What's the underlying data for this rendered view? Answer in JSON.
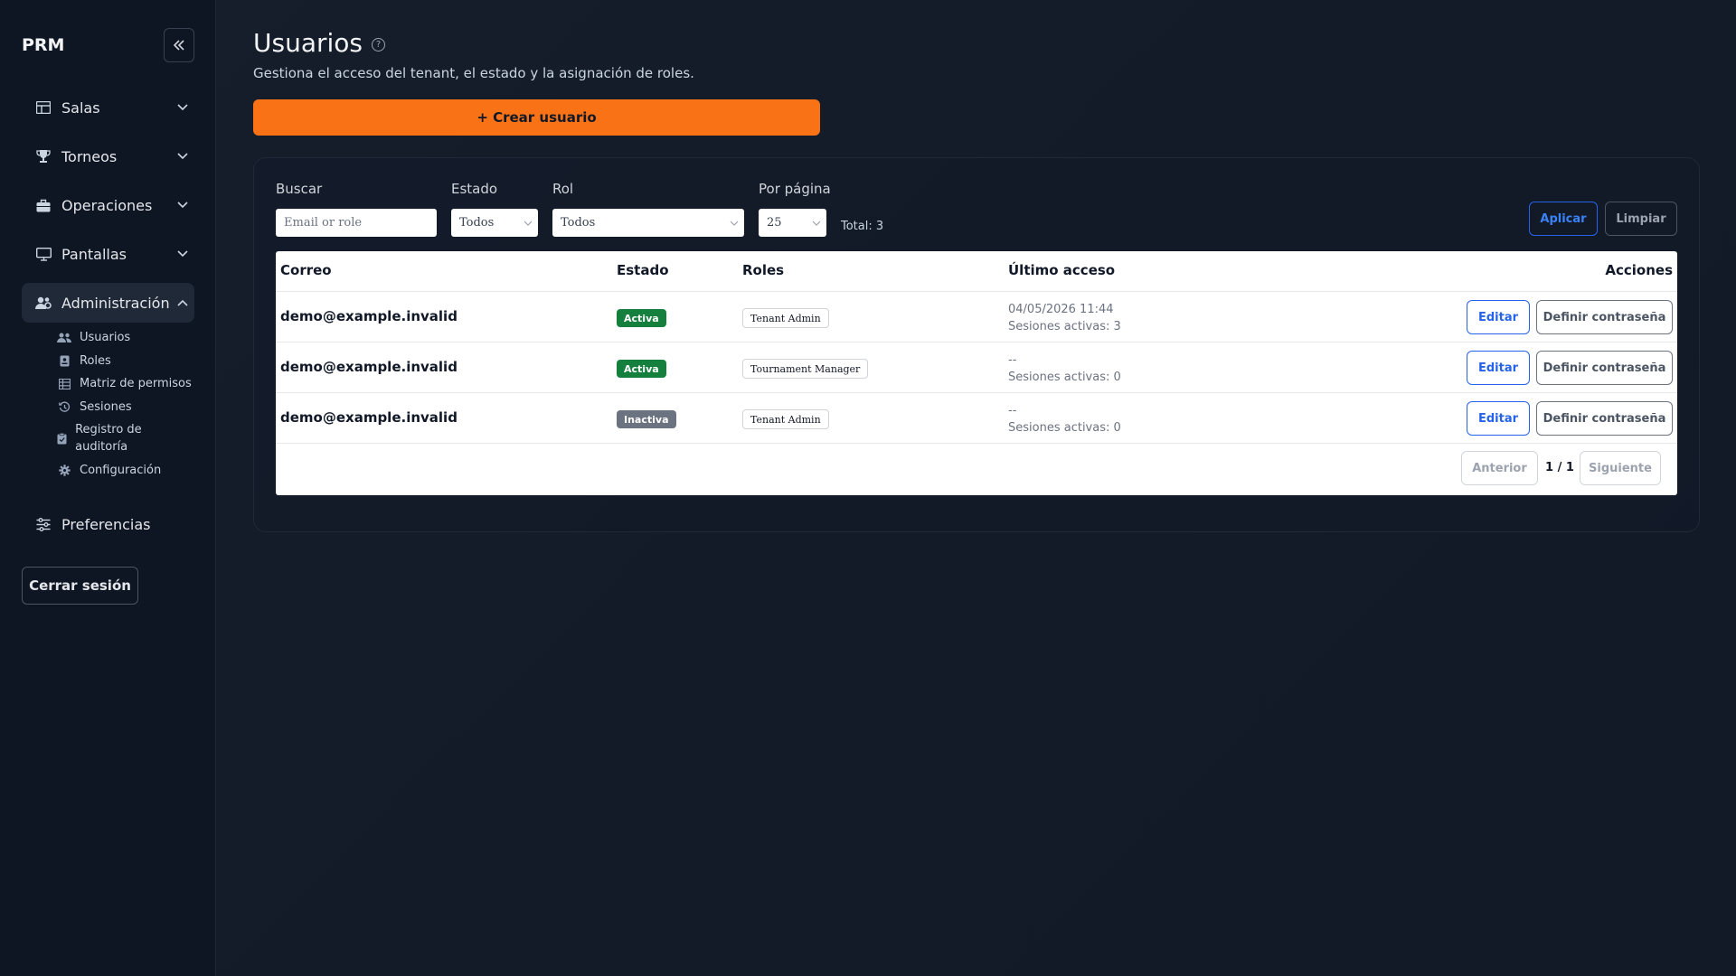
{
  "sidebar": {
    "brand": "PRM",
    "nav": [
      {
        "label": "Salas"
      },
      {
        "label": "Torneos"
      },
      {
        "label": "Operaciones"
      },
      {
        "label": "Pantallas"
      },
      {
        "label": "Administración"
      }
    ],
    "admin_items": [
      {
        "label": "Usuarios"
      },
      {
        "label": "Roles"
      },
      {
        "label": "Matriz de permisos"
      },
      {
        "label": "Sesiones"
      },
      {
        "label": "Registro de auditoría"
      },
      {
        "label": "Configuración"
      }
    ],
    "preferences": "Preferencias",
    "logout": "Cerrar sesión"
  },
  "header": {
    "title": "Usuarios",
    "subtitle": "Gestiona el acceso del tenant, el estado y la asignación de roles.",
    "create_button": "+ Crear usuario"
  },
  "filters": {
    "search_label": "Buscar",
    "search_placeholder": "Email or role",
    "status_label": "Estado",
    "status_value": "Todos",
    "role_label": "Rol",
    "role_value": "Todos",
    "per_page_label": "Por página",
    "per_page_value": "25",
    "total": "Total: 3",
    "apply": "Aplicar",
    "clear": "Limpiar"
  },
  "table": {
    "columns": [
      "Correo",
      "Estado",
      "Roles",
      "Último acceso",
      "Acciones"
    ],
    "rows": [
      {
        "email": "demo@example.invalid",
        "status": "Activa",
        "status_color": "#15803d",
        "role": "Tenant Admin",
        "last_access": "04/05/2026 11:44",
        "sessions": "Sesiones activas: 3"
      },
      {
        "email": "demo@example.invalid",
        "status": "Activa",
        "status_color": "#15803d",
        "role": "Tournament Manager",
        "last_access": "--",
        "sessions": "Sesiones activas: 0"
      },
      {
        "email": "demo@example.invalid",
        "status": "Inactiva",
        "status_color": "#6b7280",
        "role": "Tenant Admin",
        "last_access": "--",
        "sessions": "Sesiones activas: 0"
      }
    ],
    "edit_label": "Editar",
    "password_label": "Definir contraseña"
  },
  "pagination": {
    "prev": "Anterior",
    "info": "1 / 1",
    "next": "Siguiente"
  },
  "colors": {
    "accent": "#f97316",
    "primary": "#2563eb",
    "active": "#15803d",
    "inactive": "#6b7280"
  }
}
